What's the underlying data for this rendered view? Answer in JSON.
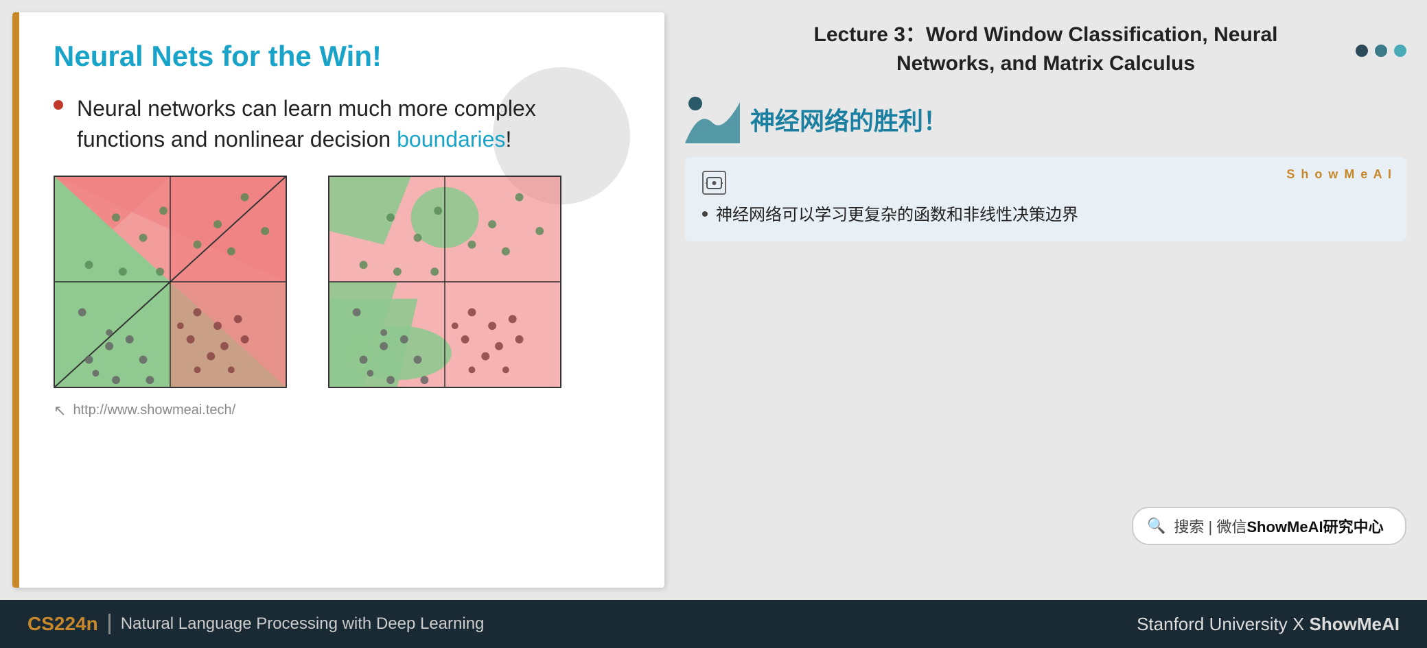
{
  "slide": {
    "title": "Neural Nets for the Win!",
    "bullet": {
      "text_normal": "Neural networks can learn much more complex\nfunctions and nonlinear decision ",
      "text_highlight": "boundaries",
      "text_end": "!"
    },
    "footer_url": "http://www.showmeai.tech/"
  },
  "right": {
    "lecture_title": "Lecture 3：Word Window Classification, Neural\nNetworks, and Matrix Calculus",
    "chinese_title": "神经网络的胜利！",
    "dots": [
      "dark",
      "teal1",
      "teal2"
    ],
    "translation_card": {
      "showmeai_label": "S h o w M e A I",
      "ai_icon_text": "⊙",
      "bullet_text": "神经网络可以学习更复杂的函数和非线性决策边界"
    },
    "search_bar": {
      "icon": "🔍",
      "label": "搜索 | 微信",
      "bold": "ShowMeAI研究中心"
    }
  },
  "bottom_bar": {
    "course_code": "CS224n",
    "divider": "|",
    "course_name": "Natural Language Processing with Deep Learning",
    "right_text": "Stanford University",
    "x_text": "X",
    "showmeai_text": "ShowMeAI"
  }
}
